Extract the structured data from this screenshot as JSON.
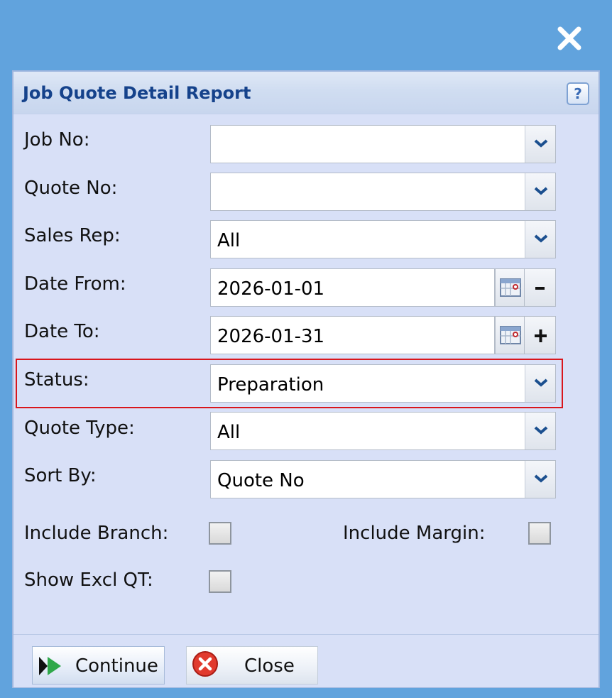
{
  "window": {
    "close_icon": "close-x-icon"
  },
  "panel": {
    "title": "Job Quote Detail Report",
    "help_label": "?"
  },
  "form": {
    "job_no": {
      "label": "Job No:",
      "value": ""
    },
    "quote_no": {
      "label": "Quote No:",
      "value": ""
    },
    "sales_rep": {
      "label": "Sales Rep:",
      "value": "All"
    },
    "date_from": {
      "label": "Date From:",
      "value": "2026-01-01"
    },
    "date_to": {
      "label": "Date To:",
      "value": "2026-01-31"
    },
    "status": {
      "label": "Status:",
      "value": "Preparation"
    },
    "quote_type": {
      "label": "Quote Type:",
      "value": "All"
    },
    "sort_by": {
      "label": "Sort By:",
      "value": "Quote No"
    },
    "include_branch": {
      "label": "Include Branch:",
      "checked": false
    },
    "include_margin": {
      "label": "Include Margin:",
      "checked": false
    },
    "show_excl_qt": {
      "label": "Show Excl QT:",
      "checked": false
    }
  },
  "footer": {
    "continue_label": "Continue",
    "close_label": "Close"
  },
  "colors": {
    "background": "#61a3dd",
    "panel": "#d8e0f7",
    "title": "#15428b",
    "highlight": "#d9161c"
  }
}
